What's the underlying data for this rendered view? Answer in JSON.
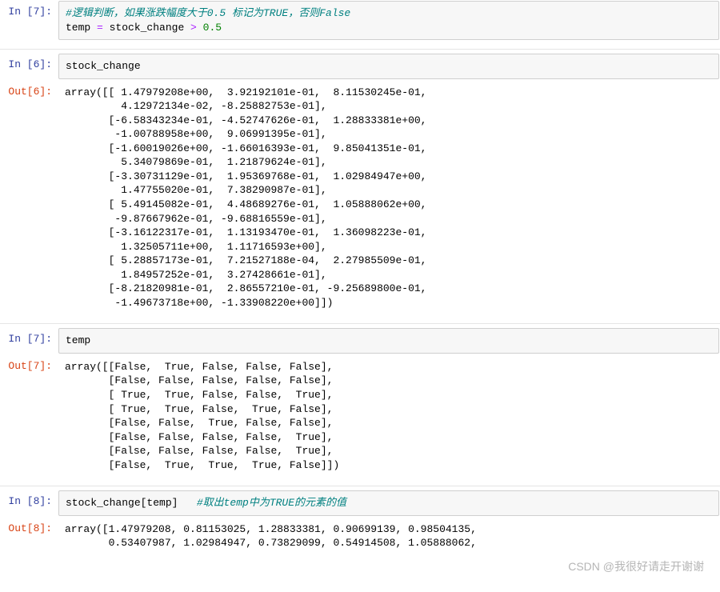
{
  "cells": [
    {
      "in_prompt": "In  [7]:",
      "code_html": "<span class='c-comment'>#逻辑判断，如果涨跌幅度大于0.5 标记为TRUE，否则False</span>\ntemp <span class='c-op'>=</span> stock_change <span class='c-op'>&gt;</span> <span class='c-num'>0.5</span>"
    },
    {
      "in_prompt": "In  [6]:",
      "code_html": "stock_change",
      "out_prompt": "Out[6]:",
      "output": "array([[ 1.47979208e+00,  3.92192101e-01,  8.11530245e-01,\n         4.12972134e-02, -8.25882753e-01],\n       [-6.58343234e-01, -4.52747626e-01,  1.28833381e+00,\n        -1.00788958e+00,  9.06991395e-01],\n       [-1.60019026e+00, -1.66016393e-01,  9.85041351e-01,\n         5.34079869e-01,  1.21879624e-01],\n       [-3.30731129e-01,  1.95369768e-01,  1.02984947e+00,\n         1.47755020e-01,  7.38290987e-01],\n       [ 5.49145082e-01,  4.48689276e-01,  1.05888062e+00,\n        -9.87667962e-01, -9.68816559e-01],\n       [-3.16122317e-01,  1.13193470e-01,  1.36098223e-01,\n         1.32505711e+00,  1.11716593e+00],\n       [ 5.28857173e-01,  7.21527188e-04,  2.27985509e-01,\n         1.84957252e-01,  3.27428661e-01],\n       [-8.21820981e-01,  2.86557210e-01, -9.25689800e-01,\n        -1.49673718e+00, -1.33908220e+00]])"
    },
    {
      "in_prompt": "In  [7]:",
      "code_html": "temp",
      "out_prompt": "Out[7]:",
      "output": "array([[False,  True, False, False, False],\n       [False, False, False, False, False],\n       [ True,  True, False, False,  True],\n       [ True,  True, False,  True, False],\n       [False, False,  True, False, False],\n       [False, False, False, False,  True],\n       [False, False, False, False,  True],\n       [False,  True,  True,  True, False]])"
    },
    {
      "in_prompt": "In  [8]:",
      "code_html": "stock_change[temp]   <span class='c-comment'>#取出temp中为TRUE的元素的值</span>",
      "out_prompt": "Out[8]:",
      "output": "array([1.47979208, 0.81153025, 1.28833381, 0.90699139, 0.98504135,\n       0.53407987, 1.02984947, 0.73829099, 0.54914508, 1.05888062,"
    }
  ],
  "watermark": "CSDN @我很好请走开谢谢"
}
